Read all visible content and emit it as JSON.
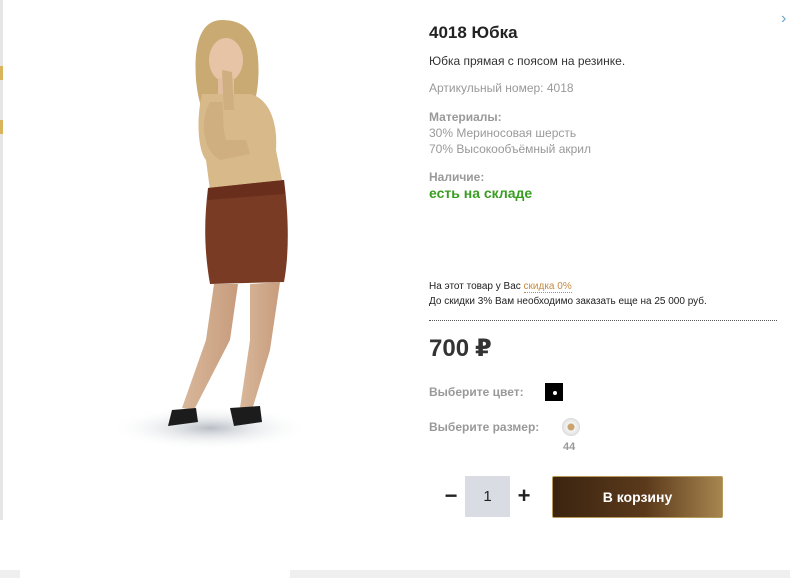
{
  "product": {
    "title": "4018 Юбка",
    "description": "Юбка прямая с поясом на резинке.",
    "sku_label": "Артикульный номер: 4018",
    "materials_heading": "Материалы:",
    "materials": [
      "30% Мериносовая шерсть",
      "70% Высокообъёмный акрил"
    ],
    "stock_heading": "Наличие:",
    "stock_value": "есть на складе"
  },
  "discount": {
    "line1_prefix": "На этот товар у Вас ",
    "line1_link": "скидка 0%",
    "line2": "До скидки 3% Вам необходимо заказать еще на 25 000 руб."
  },
  "price": {
    "amount": "700",
    "currency": "₽"
  },
  "options": {
    "color_label": "Выберите цвет:",
    "color_value": "#000000",
    "size_label": "Выберите размер:",
    "size_value": "44"
  },
  "cart": {
    "quantity": "1",
    "minus_label": "−",
    "plus_label": "+",
    "button_label": "В корзину"
  },
  "icons": {
    "right_edge": "›"
  },
  "colors": {
    "stock_green": "#3a9c22",
    "accent_brown": "#5b3a1b",
    "link_orange": "#c48b3f"
  }
}
